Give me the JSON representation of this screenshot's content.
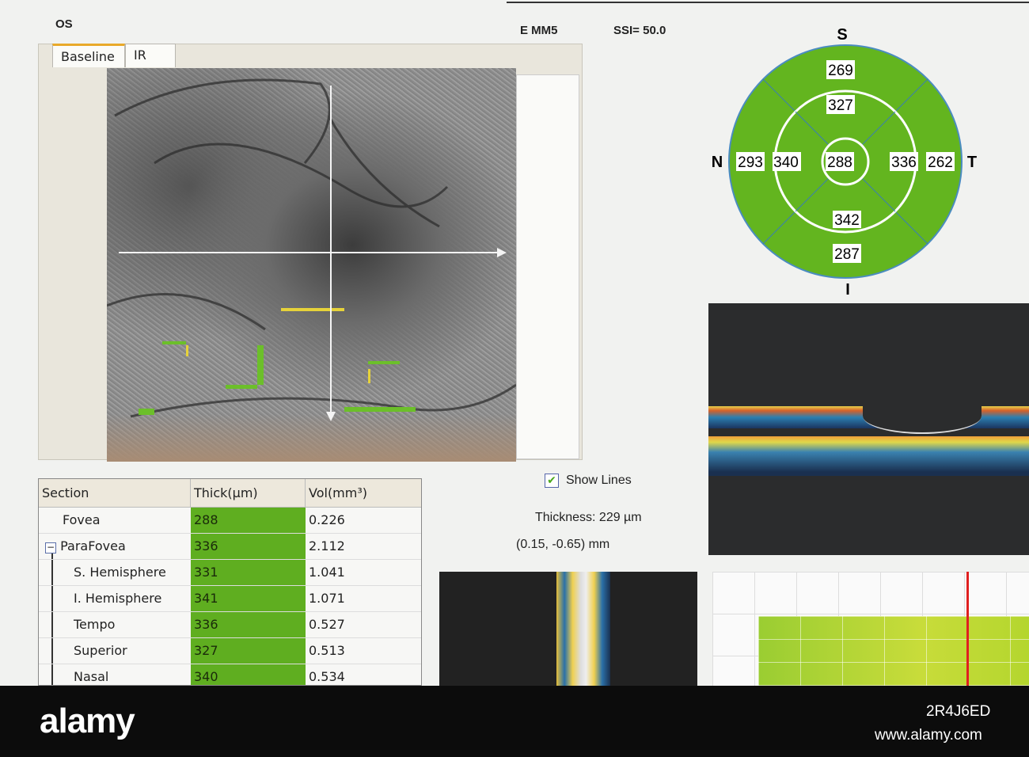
{
  "header": {
    "eye": "OS",
    "scan_type": "E MM5",
    "ssi": "SSI= 50.0"
  },
  "tabs": [
    {
      "label": "Baseline",
      "active": true
    },
    {
      "label": "IR",
      "active": false
    }
  ],
  "etdrs": {
    "labels": {
      "superior": "S",
      "inferior": "I",
      "nasal": "N",
      "temporal": "T"
    },
    "center": "288",
    "inner": {
      "superior": "327",
      "nasal": "340",
      "temporal": "336",
      "inferior": "342"
    },
    "outer": {
      "superior": "269",
      "nasal": "293",
      "temporal": "262",
      "inferior": "287"
    },
    "fill_color": "#63b51f"
  },
  "table": {
    "headers": [
      "Section",
      "Thick(µm)",
      "Vol(mm³)"
    ],
    "rows": [
      {
        "section": "Fovea",
        "thick": "288",
        "vol": "0.226"
      },
      {
        "section": "ParaFovea",
        "thick": "336",
        "vol": "2.112",
        "expander": "−"
      },
      {
        "section": "S. Hemisphere",
        "thick": "331",
        "vol": "1.041"
      },
      {
        "section": "I. Hemisphere",
        "thick": "341",
        "vol": "1.071"
      },
      {
        "section": "Tempo",
        "thick": "336",
        "vol": "0.527"
      },
      {
        "section": "Superior",
        "thick": "327",
        "vol": "0.513"
      },
      {
        "section": "Nasal",
        "thick": "340",
        "vol": "0.534"
      }
    ]
  },
  "controls": {
    "show_lines_label": "Show Lines",
    "show_lines_checked": true,
    "check_glyph": "✔"
  },
  "measure": {
    "thickness": "Thickness: 229 µm",
    "position": "(0.15, -0.65) mm"
  },
  "watermark": {
    "brand": "alamy",
    "image_id": "2R4J6ED",
    "url": "www.alamy.com"
  }
}
